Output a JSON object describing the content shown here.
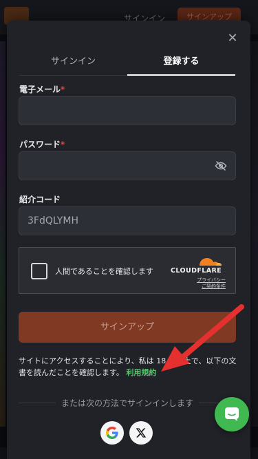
{
  "background": {
    "header_signin": "サインイン",
    "header_signup": "サインアップ"
  },
  "modal": {
    "close_icon": "close-icon",
    "tabs": [
      {
        "label": "サインイン",
        "active": false
      },
      {
        "label": "登録する",
        "active": true
      }
    ],
    "email": {
      "label": "電子メール",
      "required": "*",
      "value": ""
    },
    "password": {
      "label": "パスワード",
      "required": "*",
      "value": "",
      "icon": "eye-off-icon"
    },
    "referral": {
      "label": "紹介コード",
      "value": "3FdQLYMH"
    },
    "captcha": {
      "text": "人間であることを確認します",
      "brand": "CLOUDFLARE",
      "privacy": "プライバシー",
      "terms": "ご契約条件"
    },
    "signup_button": "サインアップ",
    "terms_text_before": "サイトにアクセスすることにより、私は 18 歳以上で、以下の文書を読んだことを確認します。",
    "terms_link": "利用規約",
    "divider": "または次の方法でサインインします",
    "social": [
      "google-icon",
      "x-icon"
    ]
  },
  "chat_button": "chat-icon",
  "colors": {
    "accent_orange": "#803a24",
    "link_green": "#58c26d",
    "chat_green": "#3fb950",
    "arrow_red": "#e53030"
  }
}
